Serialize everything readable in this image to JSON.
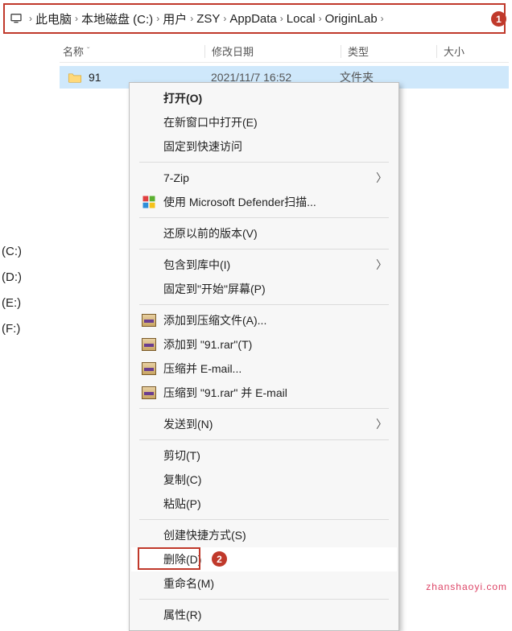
{
  "breadcrumb": {
    "items": [
      "此电脑",
      "本地磁盘 (C:)",
      "用户",
      "ZSY",
      "AppData",
      "Local",
      "OriginLab"
    ]
  },
  "columns": {
    "name": "名称",
    "date": "修改日期",
    "type": "类型",
    "size": "大小"
  },
  "row": {
    "name": "91",
    "date": "2021/11/7 16:52",
    "type": "文件夹"
  },
  "drives": [
    "(C:)",
    "(D:)",
    "(E:)",
    "(F:)"
  ],
  "menu": {
    "open": "打开(O)",
    "open_new": "在新窗口中打开(E)",
    "pin_quick": "固定到快速访问",
    "sevenzip": "7-Zip",
    "defender": "使用 Microsoft Defender扫描...",
    "restore": "还原以前的版本(V)",
    "include_lib": "包含到库中(I)",
    "pin_start": "固定到\"开始\"屏幕(P)",
    "rar_add_a": "添加到压缩文件(A)...",
    "rar_add_91": "添加到 \"91.rar\"(T)",
    "rar_email": "压缩并 E-mail...",
    "rar_email_91": "压缩到 \"91.rar\" 并 E-mail",
    "send_to": "发送到(N)",
    "cut": "剪切(T)",
    "copy": "复制(C)",
    "paste": "粘贴(P)",
    "shortcut": "创建快捷方式(S)",
    "delete": "删除(D)",
    "rename": "重命名(M)",
    "properties": "属性(R)"
  },
  "callouts": {
    "one": "1",
    "two": "2"
  },
  "watermark": "zhanshaoyi.com"
}
